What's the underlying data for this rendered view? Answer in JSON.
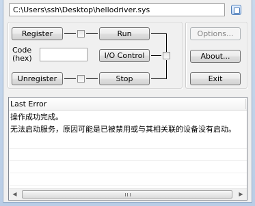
{
  "file_path": {
    "value": "C:\\Users\\ssh\\Desktop\\hellodriver.sys",
    "browse_icon": "browse-icon"
  },
  "controls": {
    "register_label": "Register",
    "unregister_label": "Unregister",
    "run_label": "Run",
    "io_control_label": "I/O Control",
    "stop_label": "Stop",
    "code_label_line1": "Code",
    "code_label_line2": "(hex)",
    "code_value": ""
  },
  "side_buttons": {
    "options_label": "Options...",
    "about_label": "About...",
    "exit_label": "Exit"
  },
  "table": {
    "header": "Last Error",
    "rows": [
      "操作成功完成。",
      "无法启动服务，原因可能是已被禁用或与其相关联的设备没有启动。"
    ],
    "scroll_left": "◀",
    "scroll_right": "▶"
  }
}
